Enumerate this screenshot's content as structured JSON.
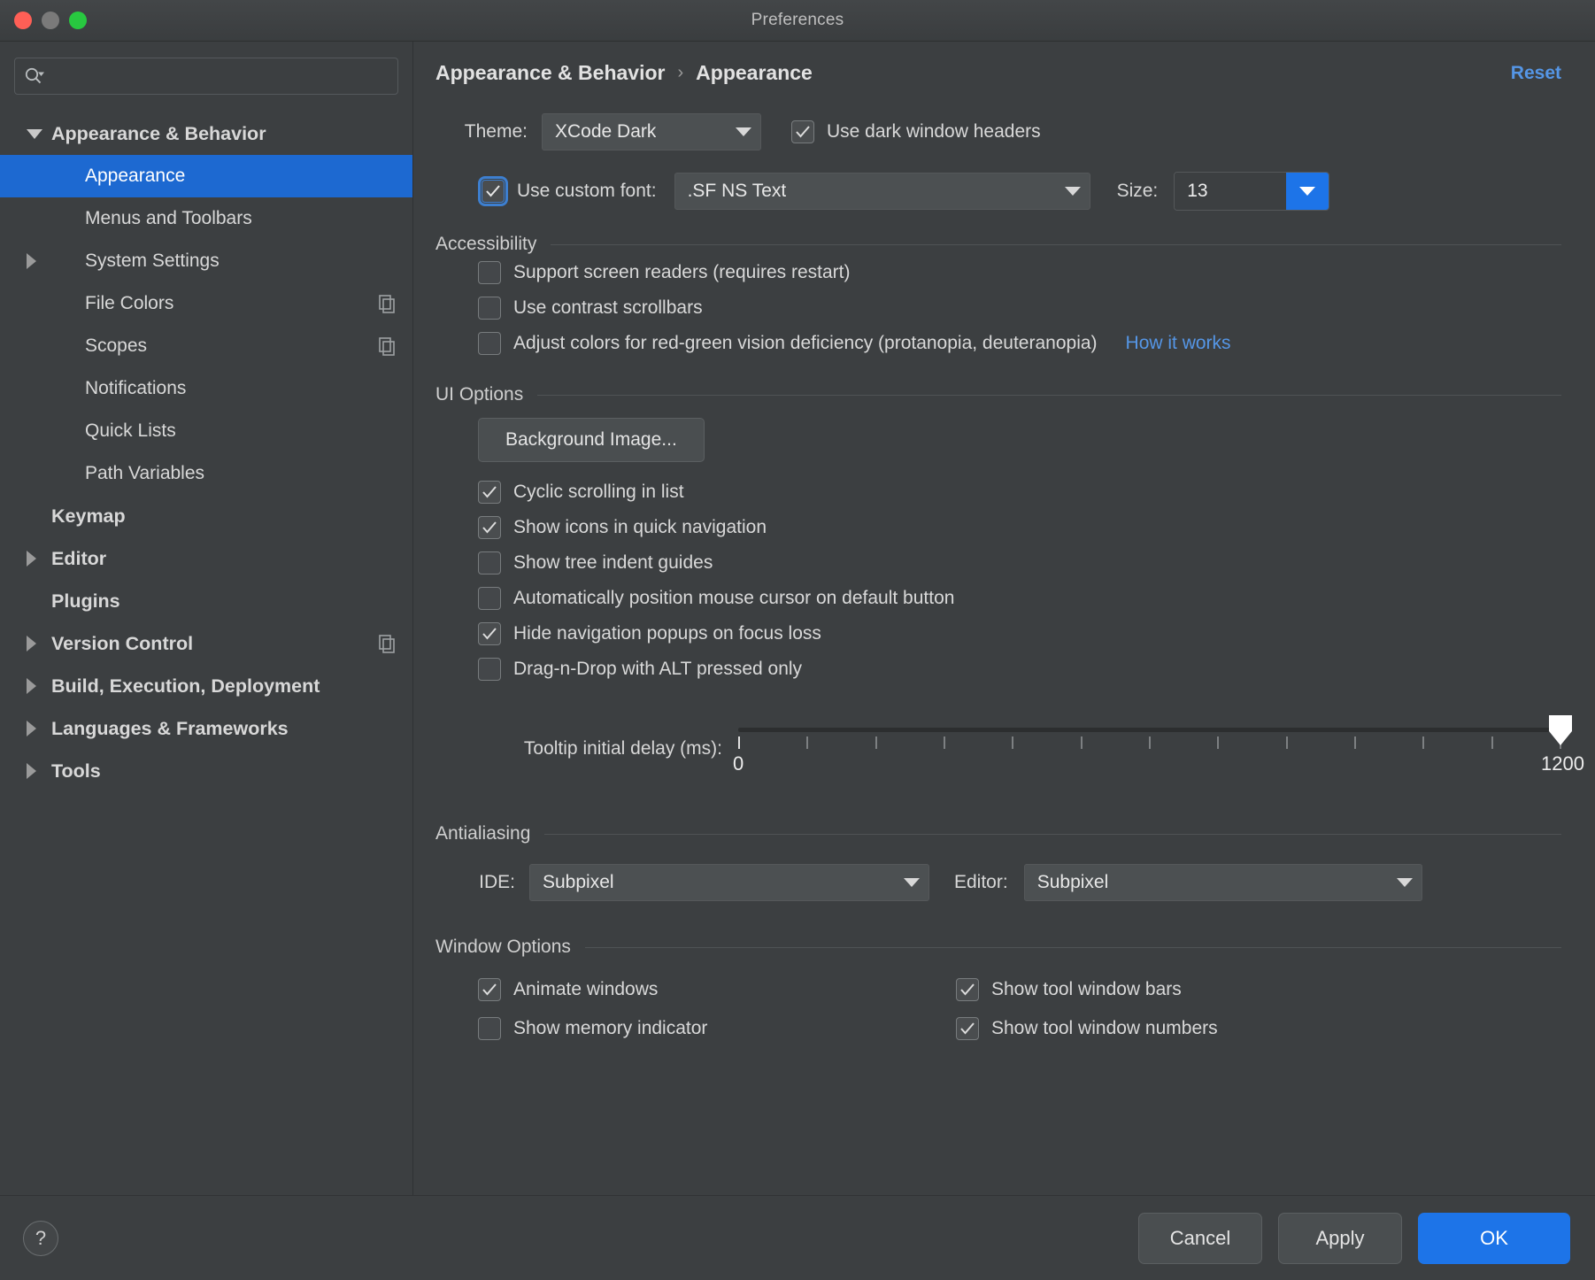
{
  "window": {
    "title": "Preferences",
    "traffic_lights": [
      "close",
      "minimize",
      "zoom"
    ]
  },
  "sidebar": {
    "search": {
      "placeholder": "",
      "value": ""
    },
    "items": [
      {
        "label": "Appearance & Behavior",
        "level": 0,
        "expander": "down",
        "selected": false,
        "bold": true,
        "copyable": false
      },
      {
        "label": "Appearance",
        "level": 1,
        "expander": "none",
        "selected": true,
        "bold": false,
        "copyable": false
      },
      {
        "label": "Menus and Toolbars",
        "level": 1,
        "expander": "none",
        "selected": false,
        "bold": false,
        "copyable": false
      },
      {
        "label": "System Settings",
        "level": 1,
        "expander": "right",
        "selected": false,
        "bold": false,
        "copyable": false
      },
      {
        "label": "File Colors",
        "level": 1,
        "expander": "none",
        "selected": false,
        "bold": false,
        "copyable": true
      },
      {
        "label": "Scopes",
        "level": 1,
        "expander": "none",
        "selected": false,
        "bold": false,
        "copyable": true
      },
      {
        "label": "Notifications",
        "level": 1,
        "expander": "none",
        "selected": false,
        "bold": false,
        "copyable": false
      },
      {
        "label": "Quick Lists",
        "level": 1,
        "expander": "none",
        "selected": false,
        "bold": false,
        "copyable": false
      },
      {
        "label": "Path Variables",
        "level": 1,
        "expander": "none",
        "selected": false,
        "bold": false,
        "copyable": false
      },
      {
        "label": "Keymap",
        "level": 0,
        "expander": "none",
        "selected": false,
        "bold": true,
        "copyable": false
      },
      {
        "label": "Editor",
        "level": 0,
        "expander": "right",
        "selected": false,
        "bold": true,
        "copyable": false
      },
      {
        "label": "Plugins",
        "level": 0,
        "expander": "none",
        "selected": false,
        "bold": true,
        "copyable": false
      },
      {
        "label": "Version Control",
        "level": 0,
        "expander": "right",
        "selected": false,
        "bold": true,
        "copyable": true
      },
      {
        "label": "Build, Execution, Deployment",
        "level": 0,
        "expander": "right",
        "selected": false,
        "bold": true,
        "copyable": false
      },
      {
        "label": "Languages & Frameworks",
        "level": 0,
        "expander": "right",
        "selected": false,
        "bold": true,
        "copyable": false
      },
      {
        "label": "Tools",
        "level": 0,
        "expander": "right",
        "selected": false,
        "bold": true,
        "copyable": false
      }
    ]
  },
  "main": {
    "breadcrumb": {
      "parent": "Appearance & Behavior",
      "separator": "›",
      "current": "Appearance"
    },
    "reset_label": "Reset",
    "theme": {
      "label": "Theme:",
      "value": "XCode Dark",
      "dark_headers": {
        "label": "Use dark window headers",
        "checked": true
      }
    },
    "custom_font": {
      "label": "Use custom font:",
      "checked": true,
      "font_value": ".SF NS Text",
      "size_label": "Size:",
      "size_value": "13"
    },
    "accessibility": {
      "title": "Accessibility",
      "options": [
        {
          "label": "Support screen readers (requires restart)",
          "checked": false
        },
        {
          "label": "Use contrast scrollbars",
          "checked": false
        },
        {
          "label": "Adjust colors for red-green vision deficiency (protanopia, deuteranopia)",
          "checked": false
        }
      ],
      "link": "How it works"
    },
    "ui_options": {
      "title": "UI Options",
      "background_image_button": "Background Image...",
      "options": [
        {
          "label": "Cyclic scrolling in list",
          "checked": true
        },
        {
          "label": "Show icons in quick navigation",
          "checked": true
        },
        {
          "label": "Show tree indent guides",
          "checked": false
        },
        {
          "label": "Automatically position mouse cursor on default button",
          "checked": false
        },
        {
          "label": "Hide navigation popups on focus loss",
          "checked": true
        },
        {
          "label": "Drag-n-Drop with ALT pressed only",
          "checked": false
        }
      ],
      "tooltip_slider": {
        "label": "Tooltip initial delay (ms):",
        "min": "0",
        "max": "1200",
        "value": "1200",
        "ticks": 13
      }
    },
    "antialiasing": {
      "title": "Antialiasing",
      "ide_label": "IDE:",
      "ide_value": "Subpixel",
      "editor_label": "Editor:",
      "editor_value": "Subpixel"
    },
    "window_options": {
      "title": "Window Options",
      "options": [
        {
          "label": "Animate windows",
          "checked": true
        },
        {
          "label": "Show tool window bars",
          "checked": true
        },
        {
          "label": "Show memory indicator",
          "checked": false
        },
        {
          "label": "Show tool window numbers",
          "checked": true
        }
      ]
    }
  },
  "footer": {
    "help_label": "?",
    "cancel_label": "Cancel",
    "apply_label": "Apply",
    "ok_label": "OK"
  },
  "colors": {
    "accent_blue": "#1d74e8",
    "selection_blue": "#1d69d1",
    "link_blue": "#5596e6",
    "panel_bg": "#3c3f41",
    "titlebar_bg": "#434648"
  },
  "watermark": {
    "text": ""
  }
}
